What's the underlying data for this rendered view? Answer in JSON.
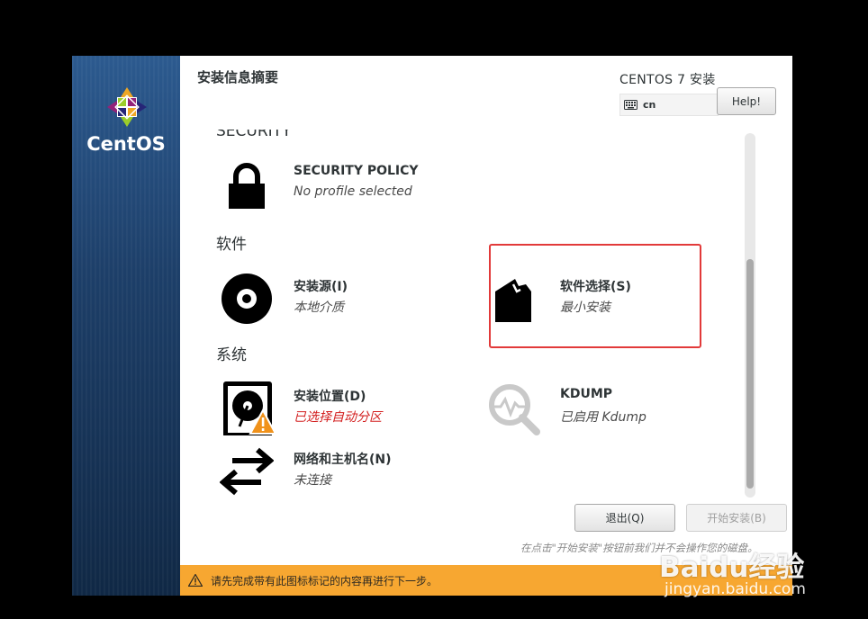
{
  "header": {
    "hub_title": "安装信息摘要",
    "product_title": "CENTOS 7 安装",
    "keyboard_layout": "cn",
    "help_label": "Help!"
  },
  "sidebar": {
    "logo_text": "CentOS"
  },
  "categories": {
    "security": "SECURITY",
    "software": "软件",
    "system": "系统"
  },
  "spokes": {
    "security_policy": {
      "title": "SECURITY POLICY",
      "status": "No profile selected"
    },
    "install_source": {
      "title": "安装源(I)",
      "status": "本地介质"
    },
    "software_selection": {
      "title": "软件选择(S)",
      "status": "最小安装"
    },
    "install_destination": {
      "title": "安装位置(D)",
      "status": "已选择自动分区"
    },
    "kdump": {
      "title": "KDUMP",
      "status": "已启用 Kdump"
    },
    "network": {
      "title": "网络和主机名(N)",
      "status": "未连接"
    }
  },
  "buttons": {
    "quit_label": "退出(Q)",
    "begin_label": "开始安装(B)"
  },
  "hint": "在点击\"开始安装\"按钮前我们并不会操作您的磁盘。",
  "warning_bar": {
    "text": "请先完成带有此图标标记的内容再进行下一步。"
  },
  "watermark": {
    "main": "Baidu经验",
    "sub": "jingyan.baidu.com"
  },
  "colors": {
    "warning_bar": "#f7a731",
    "warning_text": "#d31f1f",
    "highlight_box": "#e23a3a"
  }
}
